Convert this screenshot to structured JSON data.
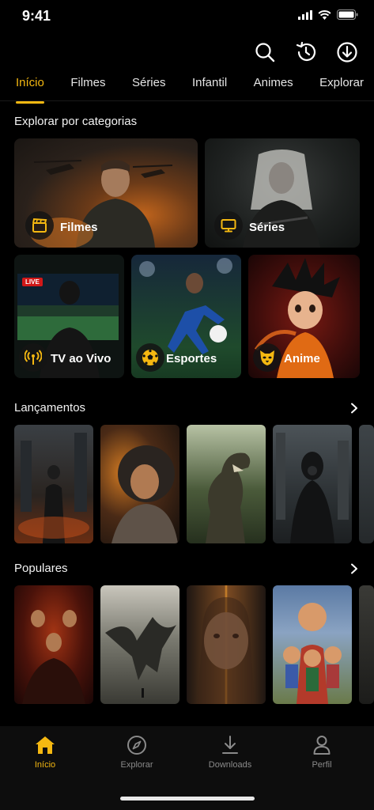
{
  "status": {
    "time": "9:41"
  },
  "colors": {
    "accent": "#f5b811",
    "background": "#000000",
    "nav_bg": "#0d0d0d"
  },
  "top_actions": [
    "search-icon",
    "history-icon",
    "download-icon"
  ],
  "tabs": [
    {
      "label": "Início",
      "active": true
    },
    {
      "label": "Filmes"
    },
    {
      "label": "Séries"
    },
    {
      "label": "Infantil"
    },
    {
      "label": "Animes"
    },
    {
      "label": "Explorar"
    }
  ],
  "categories_section": {
    "title": "Explorar por categorias",
    "items": [
      {
        "label": "Filmes",
        "icon": "clapperboard-icon"
      },
      {
        "label": "Séries",
        "icon": "monitor-icon"
      },
      {
        "label": "TV ao Vivo",
        "icon": "broadcast-icon",
        "badge": "LIVE"
      },
      {
        "label": "Esportes",
        "icon": "soccer-ball-icon"
      },
      {
        "label": "Anime",
        "icon": "cat-mask-icon"
      }
    ]
  },
  "releases": {
    "title": "Lançamentos",
    "posters": [
      "poster-1",
      "poster-2",
      "poster-3",
      "poster-4",
      "poster-5"
    ]
  },
  "popular": {
    "title": "Populares",
    "posters": [
      "poster-1",
      "poster-2",
      "poster-3",
      "poster-4",
      "poster-5"
    ]
  },
  "bottom_nav": [
    {
      "label": "Início",
      "icon": "home-icon",
      "active": true
    },
    {
      "label": "Explorar",
      "icon": "compass-icon"
    },
    {
      "label": "Downloads",
      "icon": "download-icon"
    },
    {
      "label": "Perfil",
      "icon": "user-icon"
    }
  ]
}
